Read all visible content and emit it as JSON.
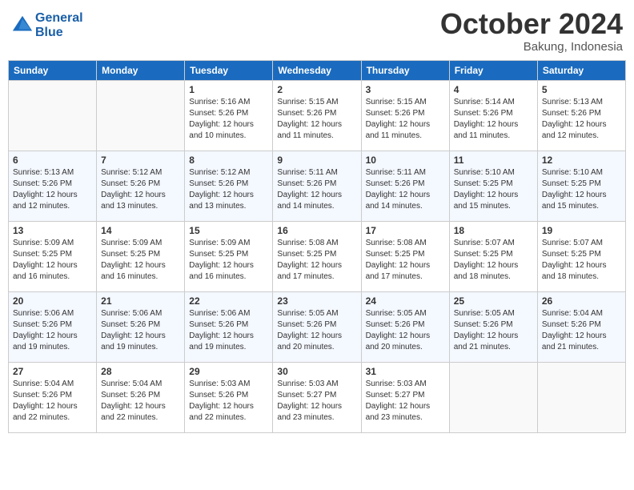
{
  "header": {
    "logo_line1": "General",
    "logo_line2": "Blue",
    "month": "October 2024",
    "location": "Bakung, Indonesia"
  },
  "weekdays": [
    "Sunday",
    "Monday",
    "Tuesday",
    "Wednesday",
    "Thursday",
    "Friday",
    "Saturday"
  ],
  "weeks": [
    [
      {
        "day": "",
        "empty": true
      },
      {
        "day": "",
        "empty": true
      },
      {
        "day": "1",
        "sunrise": "5:16 AM",
        "sunset": "5:26 PM",
        "daylight": "12 hours and 10 minutes."
      },
      {
        "day": "2",
        "sunrise": "5:15 AM",
        "sunset": "5:26 PM",
        "daylight": "12 hours and 11 minutes."
      },
      {
        "day": "3",
        "sunrise": "5:15 AM",
        "sunset": "5:26 PM",
        "daylight": "12 hours and 11 minutes."
      },
      {
        "day": "4",
        "sunrise": "5:14 AM",
        "sunset": "5:26 PM",
        "daylight": "12 hours and 11 minutes."
      },
      {
        "day": "5",
        "sunrise": "5:13 AM",
        "sunset": "5:26 PM",
        "daylight": "12 hours and 12 minutes."
      }
    ],
    [
      {
        "day": "6",
        "sunrise": "5:13 AM",
        "sunset": "5:26 PM",
        "daylight": "12 hours and 12 minutes."
      },
      {
        "day": "7",
        "sunrise": "5:12 AM",
        "sunset": "5:26 PM",
        "daylight": "12 hours and 13 minutes."
      },
      {
        "day": "8",
        "sunrise": "5:12 AM",
        "sunset": "5:26 PM",
        "daylight": "12 hours and 13 minutes."
      },
      {
        "day": "9",
        "sunrise": "5:11 AM",
        "sunset": "5:26 PM",
        "daylight": "12 hours and 14 minutes."
      },
      {
        "day": "10",
        "sunrise": "5:11 AM",
        "sunset": "5:26 PM",
        "daylight": "12 hours and 14 minutes."
      },
      {
        "day": "11",
        "sunrise": "5:10 AM",
        "sunset": "5:25 PM",
        "daylight": "12 hours and 15 minutes."
      },
      {
        "day": "12",
        "sunrise": "5:10 AM",
        "sunset": "5:25 PM",
        "daylight": "12 hours and 15 minutes."
      }
    ],
    [
      {
        "day": "13",
        "sunrise": "5:09 AM",
        "sunset": "5:25 PM",
        "daylight": "12 hours and 16 minutes."
      },
      {
        "day": "14",
        "sunrise": "5:09 AM",
        "sunset": "5:25 PM",
        "daylight": "12 hours and 16 minutes."
      },
      {
        "day": "15",
        "sunrise": "5:09 AM",
        "sunset": "5:25 PM",
        "daylight": "12 hours and 16 minutes."
      },
      {
        "day": "16",
        "sunrise": "5:08 AM",
        "sunset": "5:25 PM",
        "daylight": "12 hours and 17 minutes."
      },
      {
        "day": "17",
        "sunrise": "5:08 AM",
        "sunset": "5:25 PM",
        "daylight": "12 hours and 17 minutes."
      },
      {
        "day": "18",
        "sunrise": "5:07 AM",
        "sunset": "5:25 PM",
        "daylight": "12 hours and 18 minutes."
      },
      {
        "day": "19",
        "sunrise": "5:07 AM",
        "sunset": "5:25 PM",
        "daylight": "12 hours and 18 minutes."
      }
    ],
    [
      {
        "day": "20",
        "sunrise": "5:06 AM",
        "sunset": "5:26 PM",
        "daylight": "12 hours and 19 minutes."
      },
      {
        "day": "21",
        "sunrise": "5:06 AM",
        "sunset": "5:26 PM",
        "daylight": "12 hours and 19 minutes."
      },
      {
        "day": "22",
        "sunrise": "5:06 AM",
        "sunset": "5:26 PM",
        "daylight": "12 hours and 19 minutes."
      },
      {
        "day": "23",
        "sunrise": "5:05 AM",
        "sunset": "5:26 PM",
        "daylight": "12 hours and 20 minutes."
      },
      {
        "day": "24",
        "sunrise": "5:05 AM",
        "sunset": "5:26 PM",
        "daylight": "12 hours and 20 minutes."
      },
      {
        "day": "25",
        "sunrise": "5:05 AM",
        "sunset": "5:26 PM",
        "daylight": "12 hours and 21 minutes."
      },
      {
        "day": "26",
        "sunrise": "5:04 AM",
        "sunset": "5:26 PM",
        "daylight": "12 hours and 21 minutes."
      }
    ],
    [
      {
        "day": "27",
        "sunrise": "5:04 AM",
        "sunset": "5:26 PM",
        "daylight": "12 hours and 22 minutes."
      },
      {
        "day": "28",
        "sunrise": "5:04 AM",
        "sunset": "5:26 PM",
        "daylight": "12 hours and 22 minutes."
      },
      {
        "day": "29",
        "sunrise": "5:03 AM",
        "sunset": "5:26 PM",
        "daylight": "12 hours and 22 minutes."
      },
      {
        "day": "30",
        "sunrise": "5:03 AM",
        "sunset": "5:27 PM",
        "daylight": "12 hours and 23 minutes."
      },
      {
        "day": "31",
        "sunrise": "5:03 AM",
        "sunset": "5:27 PM",
        "daylight": "12 hours and 23 minutes."
      },
      {
        "day": "",
        "empty": true
      },
      {
        "day": "",
        "empty": true
      }
    ]
  ],
  "labels": {
    "sunrise_prefix": "Sunrise: ",
    "sunset_prefix": "Sunset: ",
    "daylight_prefix": "Daylight: "
  }
}
